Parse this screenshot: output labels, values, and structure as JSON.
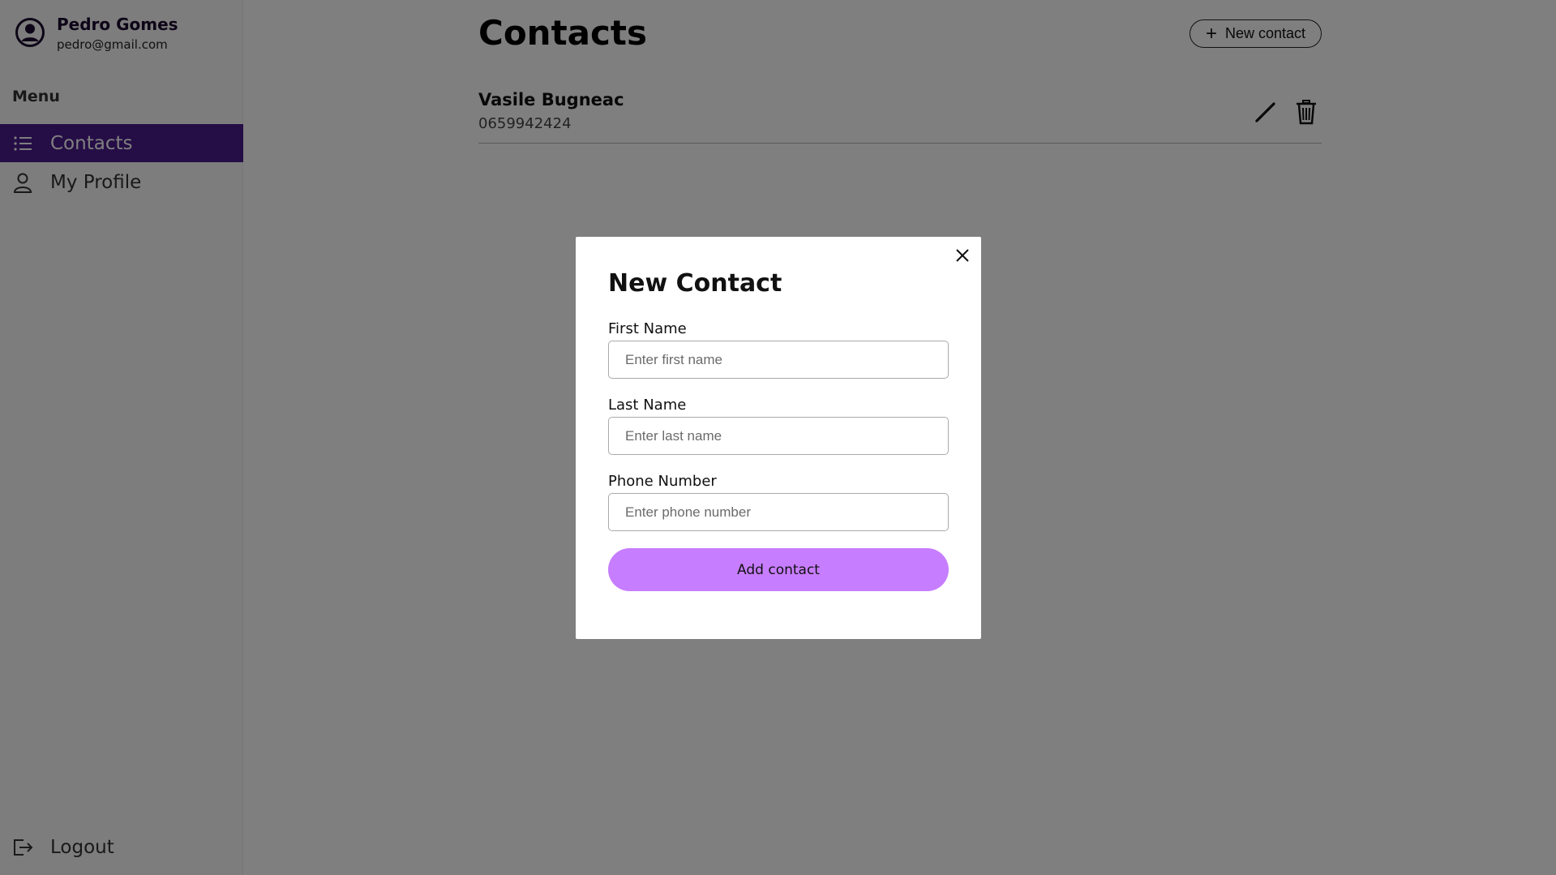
{
  "user": {
    "name": "Pedro Gomes",
    "email": "pedro@gmail.com"
  },
  "sidebar": {
    "menu_heading": "Menu",
    "items": [
      {
        "label": "Contacts",
        "icon": "list-icon",
        "active": true
      },
      {
        "label": "My Profile",
        "icon": "person-icon",
        "active": false
      }
    ],
    "logout_label": "Logout"
  },
  "main": {
    "title": "Contacts",
    "new_contact_label": "New contact",
    "contacts": [
      {
        "name": "Vasile Bugneac",
        "phone": "0659942424"
      }
    ]
  },
  "modal": {
    "title": "New Contact",
    "fields": {
      "first_name": {
        "label": "First Name",
        "placeholder": "Enter first name",
        "value": ""
      },
      "last_name": {
        "label": "Last Name",
        "placeholder": "Enter last name",
        "value": ""
      },
      "phone": {
        "label": "Phone Number",
        "placeholder": "Enter phone number",
        "value": ""
      }
    },
    "submit_label": "Add contact"
  },
  "colors": {
    "accent": "#4a1a8c",
    "button_primary": "#c77dff",
    "overlay": "rgba(0,0,0,0.5)"
  }
}
